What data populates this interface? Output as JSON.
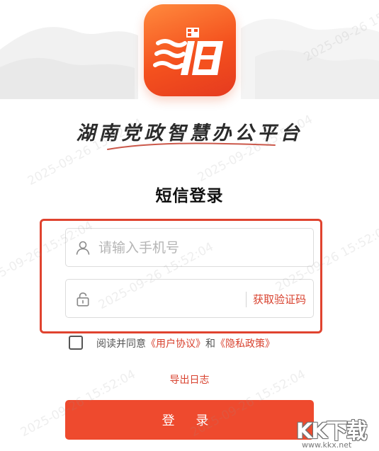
{
  "app": {
    "platform_title": "湖南党政智慧办公平台",
    "login_heading": "短信登录"
  },
  "form": {
    "phone_placeholder": "请输入手机号",
    "code_value": "",
    "get_code_label": "获取验证码"
  },
  "agreement": {
    "prefix": "阅读并同意",
    "user_agreement": "《用户协议》",
    "and": "和",
    "privacy_policy": "《隐私政策》",
    "checked": false
  },
  "actions": {
    "export_log": "导出日志",
    "login": "登 录"
  },
  "watermark": {
    "text": "2025-09-26 15:52:04"
  },
  "site_badge": {
    "brand": "KK下载",
    "url": "www.kkx.net"
  },
  "icons": {
    "user": "user-icon",
    "lock": "lock-icon",
    "logo": "app-logo-icon"
  },
  "colors": {
    "accent": "#ee4a2e",
    "link": "#d8412e",
    "logo_top": "#ff8a3d",
    "logo_bottom": "#e53a1f"
  }
}
